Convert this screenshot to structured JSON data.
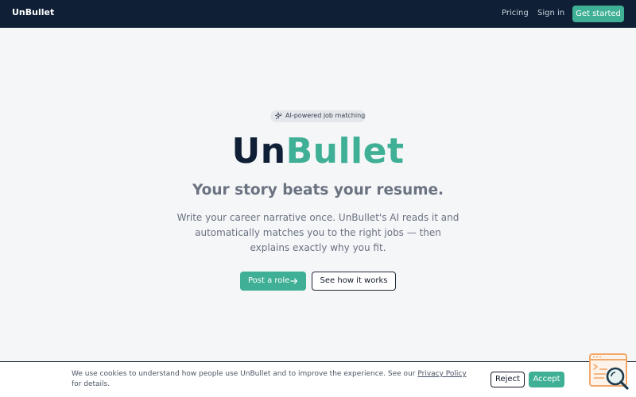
{
  "nav": {
    "brand": "UnBullet",
    "links": [
      {
        "label": "Pricing"
      },
      {
        "label": "Sign in"
      }
    ],
    "cta_label": "Get started"
  },
  "hero": {
    "badge": {
      "icon": "sparkles-icon",
      "text": "AI-powered job matching"
    },
    "title_part1": "Un",
    "title_part2": "Bullet",
    "tagline": "Your story beats your resume.",
    "description": "Write your career narrative once. UnBullet's AI reads it and automatically matches you to the right jobs — then explains exactly why you fit.",
    "primary_button": {
      "label": "Post a role",
      "icon": "arrow-right-icon"
    },
    "secondary_button": {
      "label": "See how it works"
    }
  },
  "cookie_banner": {
    "text_before": "We use cookies to understand how people use UnBullet and to improve the experience. See our ",
    "link_text": "Privacy Policy",
    "text_after": " for details.",
    "reject_label": "Reject",
    "accept_label": "Accept"
  },
  "widget": {
    "icon": "search-document-icon"
  },
  "colors": {
    "navbar": "#0f1f35",
    "accent": "#3fb095",
    "background": "#f4f6f8",
    "widget": "#f3a86b"
  }
}
